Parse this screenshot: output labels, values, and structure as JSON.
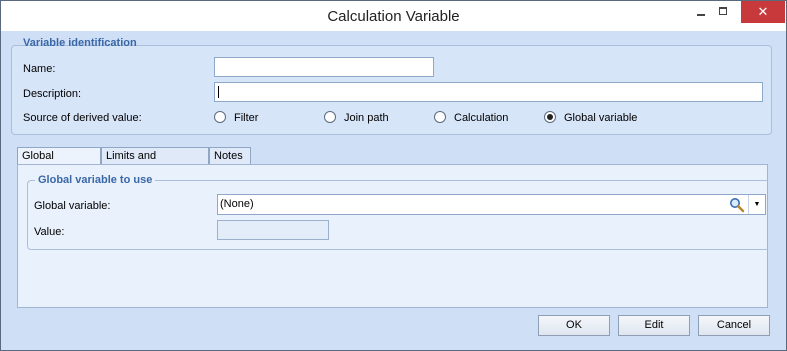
{
  "window": {
    "title": "Calculation Variable",
    "controls": {
      "minimize": "–",
      "close": "✕"
    }
  },
  "identification": {
    "group_title": "Variable identification",
    "name_label": "Name:",
    "name_value": "",
    "description_label": "Description:",
    "description_value": "",
    "source_label": "Source of derived value:",
    "source_options": [
      {
        "label": "Filter",
        "selected": false
      },
      {
        "label": "Join path",
        "selected": false
      },
      {
        "label": "Calculation",
        "selected": false
      },
      {
        "label": "Global variable",
        "selected": true
      }
    ]
  },
  "tabs": [
    {
      "label": "Global Variable",
      "active": true
    },
    {
      "label": "Limits and Weighting",
      "active": false
    },
    {
      "label": "Notes",
      "active": false
    }
  ],
  "global_panel": {
    "group_title": "Global variable to use",
    "global_variable_label": "Global variable:",
    "global_variable_value": "(None)",
    "value_label": "Value:",
    "value_value": ""
  },
  "buttons": {
    "ok": "OK",
    "edit": "Edit",
    "cancel": "Cancel"
  },
  "colors": {
    "background": "#cfe0f6",
    "group_title": "#3a67a7",
    "close_button": "#c7393b"
  },
  "icons": {
    "search": "magnifier-icon",
    "dropdown": "chevron-down-icon"
  }
}
